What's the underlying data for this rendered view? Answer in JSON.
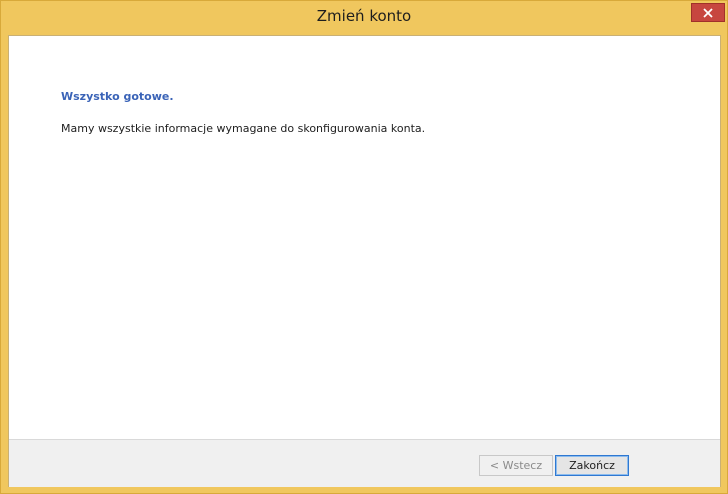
{
  "window": {
    "title": "Zmień konto",
    "close_icon": "close-icon"
  },
  "content": {
    "heading": "Wszystko gotowe.",
    "message": "Mamy wszystkie informacje wymagane do skonfigurowania konta."
  },
  "footer": {
    "back_label": "< Wstecz",
    "finish_label": "Zakończ"
  },
  "colors": {
    "frame": "#f0c75e",
    "close": "#c7463f",
    "heading": "#3a63b7",
    "default_button_border": "#2f78d1"
  }
}
